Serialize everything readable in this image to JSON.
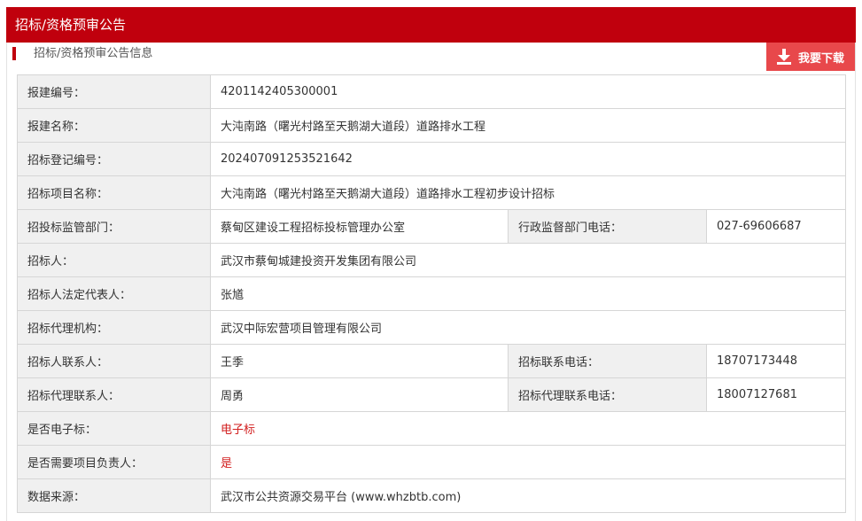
{
  "header": {
    "title": "招标/资格预审公告"
  },
  "subheader": {
    "title": "招标/资格预审公告信息"
  },
  "toolbar": {
    "download_label": "我要下载",
    "download_icon": "download-icon"
  },
  "colors": {
    "brand_red": "#c0000d",
    "button_red": "#e8484b",
    "highlight_red": "#d21f1f"
  },
  "info": {
    "project_code": {
      "label": "报建编号：",
      "value": "4201142405300001"
    },
    "project_name": {
      "label": "报建名称：",
      "value": "大沌南路（曙光村路至天鹅湖大道段）道路排水工程"
    },
    "tender_reg_no": {
      "label": "招标登记编号：",
      "value": "202407091253521642"
    },
    "tender_project_name": {
      "label": "招标项目名称：",
      "value": "大沌南路（曙光村路至天鹅湖大道段）道路排水工程初步设计招标"
    },
    "supervision_dept": {
      "label": "招投标监管部门：",
      "value": "蔡甸区建设工程招标投标管理办公室"
    },
    "supervision_phone": {
      "label": "行政监督部门电话：",
      "value": "027-69606687"
    },
    "tenderer": {
      "label": "招标人：",
      "value": "武汉市蔡甸城建投资开发集团有限公司"
    },
    "legal_rep": {
      "label": "招标人法定代表人：",
      "value": "张馗"
    },
    "agency": {
      "label": "招标代理机构：",
      "value": "武汉中际宏营项目管理有限公司"
    },
    "tenderer_contact": {
      "label": "招标人联系人：",
      "value": "王季"
    },
    "tenderer_phone": {
      "label": "招标联系电话：",
      "value": "18707173448"
    },
    "agency_contact": {
      "label": "招标代理联系人：",
      "value": "周勇"
    },
    "agency_phone": {
      "label": "招标代理联系电话：",
      "value": "18007127681"
    },
    "electronic_bid": {
      "label": "是否电子标：",
      "value": "电子标"
    },
    "need_pm": {
      "label": "是否需要项目负责人：",
      "value": "是"
    },
    "data_source": {
      "label": "数据来源：",
      "value": "武汉市公共资源交易平台 (www.whzbtb.com)"
    }
  }
}
